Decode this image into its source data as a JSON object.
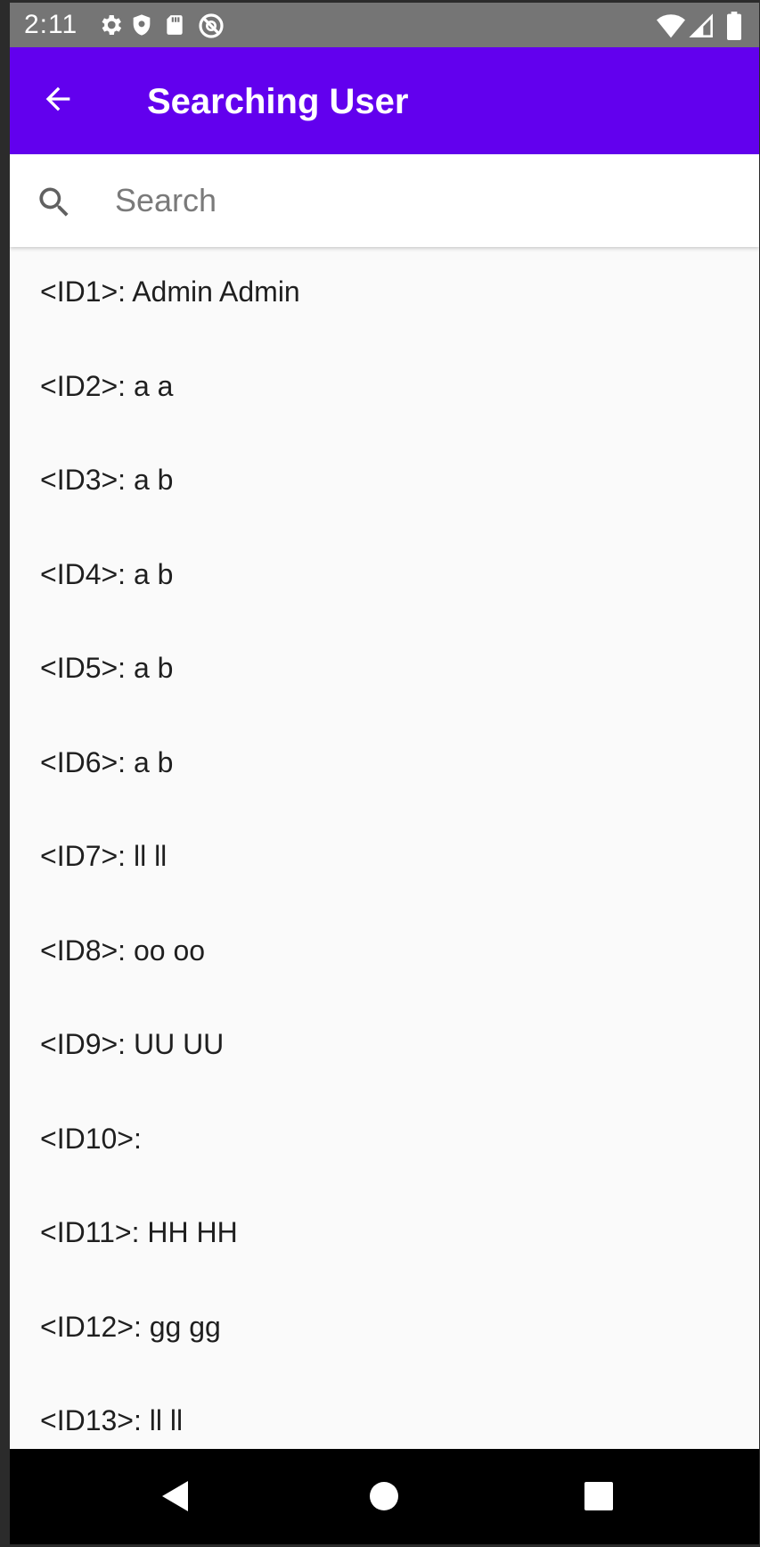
{
  "status_bar": {
    "time": "2:11",
    "icons": [
      "settings-icon",
      "shield-icon",
      "sd-card-icon",
      "no-disturb-icon",
      "wifi-icon",
      "signal-icon",
      "battery-icon"
    ]
  },
  "app_bar": {
    "title": "Searching User",
    "back_icon": "arrow-back-icon",
    "color": "#6200ee"
  },
  "search": {
    "placeholder": "Search",
    "value": "",
    "icon": "search-icon"
  },
  "users": [
    "<ID1>: Admin Admin",
    "<ID2>: a a",
    "<ID3>: a b",
    "<ID4>: a b",
    "<ID5>: a b",
    "<ID6>: a b",
    "<ID7>: ll ll",
    "<ID8>: oo oo",
    "<ID9>: UU UU",
    "<ID10>:",
    "<ID11>: HH HH",
    "<ID12>: gg gg",
    "<ID13>: ll ll"
  ],
  "nav_bar": {
    "icons": [
      "back-triangle-icon",
      "home-circle-icon",
      "recents-square-icon"
    ]
  }
}
